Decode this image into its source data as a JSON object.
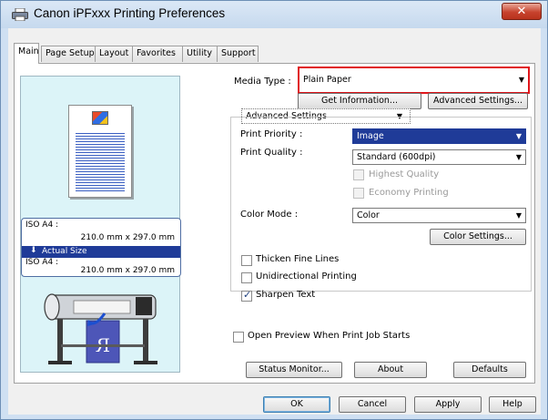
{
  "window": {
    "title": "Canon iPFxxx Printing Preferences",
    "close_glyph": "✕"
  },
  "tabs": [
    {
      "label": "Main",
      "active": true
    },
    {
      "label": "Page Setup",
      "active": false
    },
    {
      "label": "Layout",
      "active": false
    },
    {
      "label": "Favorites",
      "active": false
    },
    {
      "label": "Utility",
      "active": false
    },
    {
      "label": "Support",
      "active": false
    }
  ],
  "preview": {
    "orig_size_label": "ISO A4 :",
    "orig_size_dims": "210.0 mm x 297.0 mm",
    "actual_size_label": "Actual Size",
    "actual_arrow": "⬇",
    "output_size_label": "ISO A4 :",
    "output_size_dims": "210.0 mm x 297.0 mm",
    "output_letter": "R"
  },
  "media": {
    "label": "Media Type :",
    "value": "Plain Paper",
    "get_info_button": "Get Information...",
    "advanced_button": "Advanced Settings..."
  },
  "mode_select": {
    "value": "Advanced Settings"
  },
  "print_priority": {
    "label": "Print Priority :",
    "value": "Image"
  },
  "print_quality": {
    "label": "Print Quality :",
    "value": "Standard (600dpi)",
    "highest_quality": "Highest Quality",
    "economy_printing": "Economy Printing"
  },
  "color_mode": {
    "label": "Color Mode :",
    "value": "Color",
    "settings_button": "Color Settings..."
  },
  "options": {
    "thicken_lines": "Thicken Fine Lines",
    "unidirectional": "Unidirectional Printing",
    "sharpen_text": "Sharpen Text",
    "open_preview": "Open Preview When Print Job Starts"
  },
  "panel_buttons": {
    "status_monitor": "Status Monitor...",
    "about": "About",
    "defaults": "Defaults"
  },
  "dialog_buttons": {
    "ok": "OK",
    "cancel": "Cancel",
    "apply": "Apply",
    "help": "Help"
  },
  "icons": {
    "dropdown": "▼",
    "check": "✓"
  },
  "colors": {
    "highlight_border": "#e0161b",
    "selected_select_bg": "#1f3b98"
  }
}
